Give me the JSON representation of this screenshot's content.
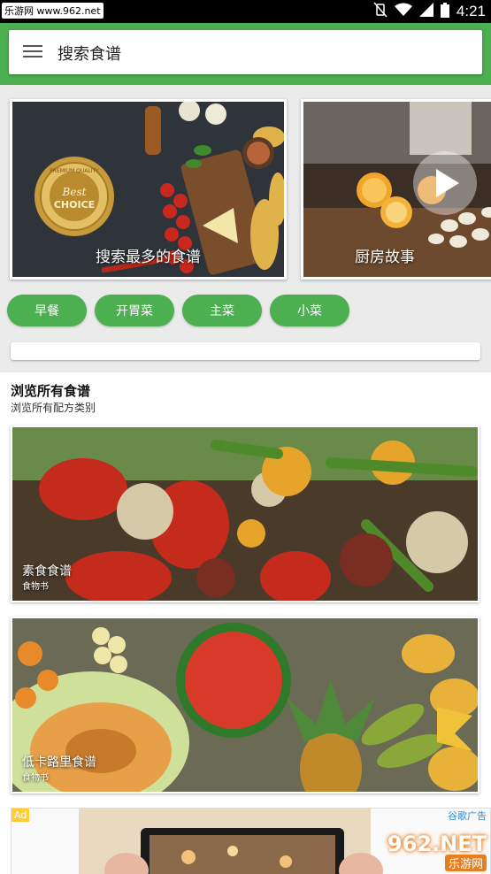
{
  "status_bar": {
    "watermark": "乐游网 www.962.net",
    "time": "4:21"
  },
  "header": {
    "menu_icon": "hamburger-menu-icon",
    "search_title": "搜索食谱"
  },
  "featured": [
    {
      "label": "搜索最多的食谱",
      "badge_text_top": "PREMIUM QUALITY",
      "badge_main": "Best",
      "badge_sub": "CHOICE"
    },
    {
      "label": "厨房故事",
      "icon": "play-icon"
    }
  ],
  "chips": [
    "早餐",
    "开胃菜",
    "主菜",
    "小菜"
  ],
  "browse": {
    "title": "浏览所有食谱",
    "subtitle": "浏览所有配方类别",
    "categories": [
      {
        "name": "素食食谱",
        "sub": "食物书"
      },
      {
        "name": "低卡路里食谱",
        "sub": "食物书"
      }
    ]
  },
  "ad": {
    "tag": "Ad",
    "google_label": "谷歌广告",
    "watermark_main": "962.NET",
    "watermark_sub": "乐游网"
  },
  "colors": {
    "primary_green": "#4caf50",
    "status_bar": "#000000"
  }
}
